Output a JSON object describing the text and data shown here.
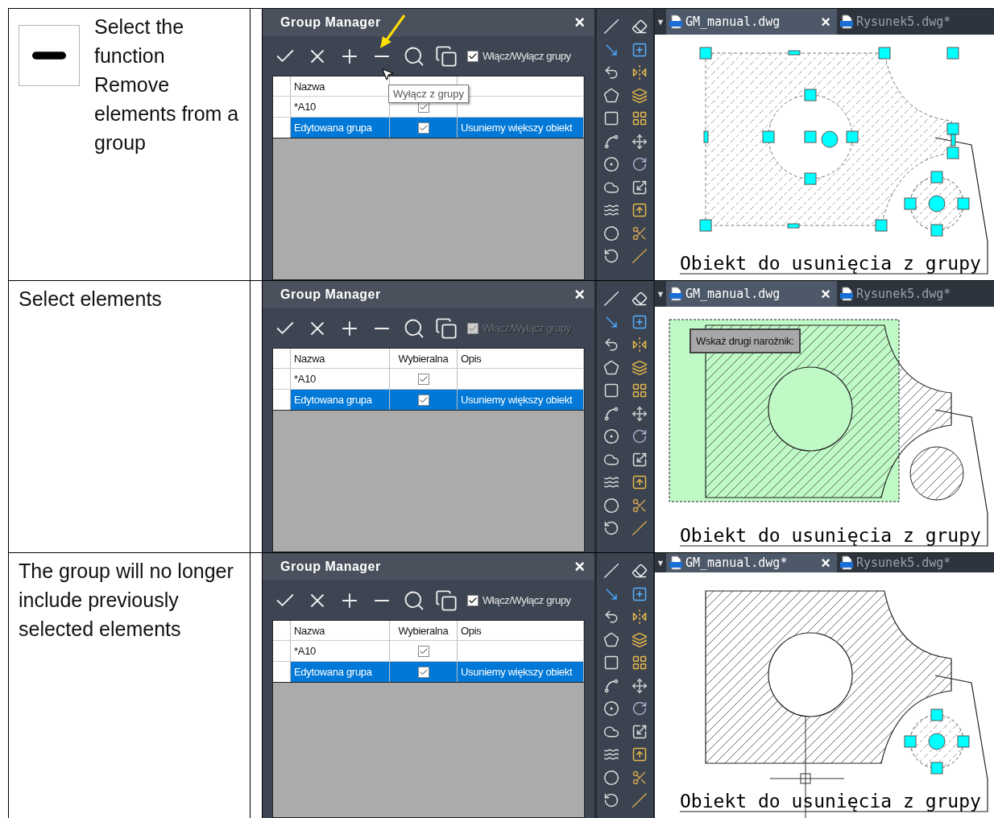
{
  "steps": [
    {
      "kind": "with-icon",
      "instruction": "Select the function Remove elements from a group",
      "panel": {
        "title": "Group Manager",
        "close": "×",
        "toggle": {
          "label": "Włącz/Wyłącz grupy",
          "checked": true,
          "disabled": false
        },
        "columns": [
          "Nazwa"
        ],
        "rows": [
          {
            "name": "*A10",
            "selectable": true,
            "selected": false
          },
          {
            "name": "Edytowana grupa",
            "selectable": true,
            "description": "Usuniemy większy obiekt",
            "selected": true
          }
        ],
        "tooltip": "Wyłącz z grupy",
        "highlight_arrow": true
      },
      "canvas": {
        "menu": "▼",
        "tabs": [
          {
            "label": "GM_manual.dwg",
            "close": "×",
            "selected": true
          },
          {
            "label": "Rysunek5.dwg*",
            "selected": false
          }
        ],
        "drawing": {
          "kind": "grips",
          "caption": "Obiekt do usunięcia z grupy"
        }
      }
    },
    {
      "kind": "text",
      "instruction": "Select elements",
      "panel": {
        "title": "Group Manager",
        "close": "×",
        "toggle": {
          "label": "Włącz/Wyłącz grupy",
          "checked": true,
          "disabled": true
        },
        "columns": [
          "Nazwa",
          "Wybieralna",
          "Opis"
        ],
        "rows": [
          {
            "name": "*A10",
            "selectable": true,
            "selected": false
          },
          {
            "name": "Edytowana grupa",
            "selectable": true,
            "description": "Usuniemy większy obiekt",
            "selected": true
          }
        ]
      },
      "canvas": {
        "menu": "▼",
        "tabs": [
          {
            "label": "GM_manual.dwg",
            "close": "×",
            "selected": true
          },
          {
            "label": "Rysunek5.dwg*",
            "selected": false
          }
        ],
        "drawing": {
          "kind": "window",
          "prompt": "Wskaż drugi narożnik:",
          "caption": "Obiekt do usunięcia z grupy"
        }
      }
    },
    {
      "kind": "text",
      "instruction": "The group will no longer include previously selected elements",
      "panel": {
        "title": "Group Manager",
        "close": "×",
        "toggle": {
          "label": "Włącz/Wyłącz grupy",
          "checked": true,
          "disabled": false
        },
        "columns": [
          "Nazwa",
          "Wybieralna",
          "Opis"
        ],
        "rows": [
          {
            "name": "*A10",
            "selectable": true,
            "selected": false
          },
          {
            "name": "Edytowana grupa",
            "selectable": true,
            "description": "Usuniemy większy obiekt",
            "selected": true
          }
        ]
      },
      "canvas": {
        "menu": "▼",
        "tabs": [
          {
            "label": "GM_manual.dwg*",
            "close": "×",
            "selected": true
          },
          {
            "label": "Rysunek5.dwg*",
            "selected": false
          }
        ],
        "drawing": {
          "kind": "removed",
          "caption": "Obiekt do usunięcia z grupy"
        }
      }
    }
  ]
}
